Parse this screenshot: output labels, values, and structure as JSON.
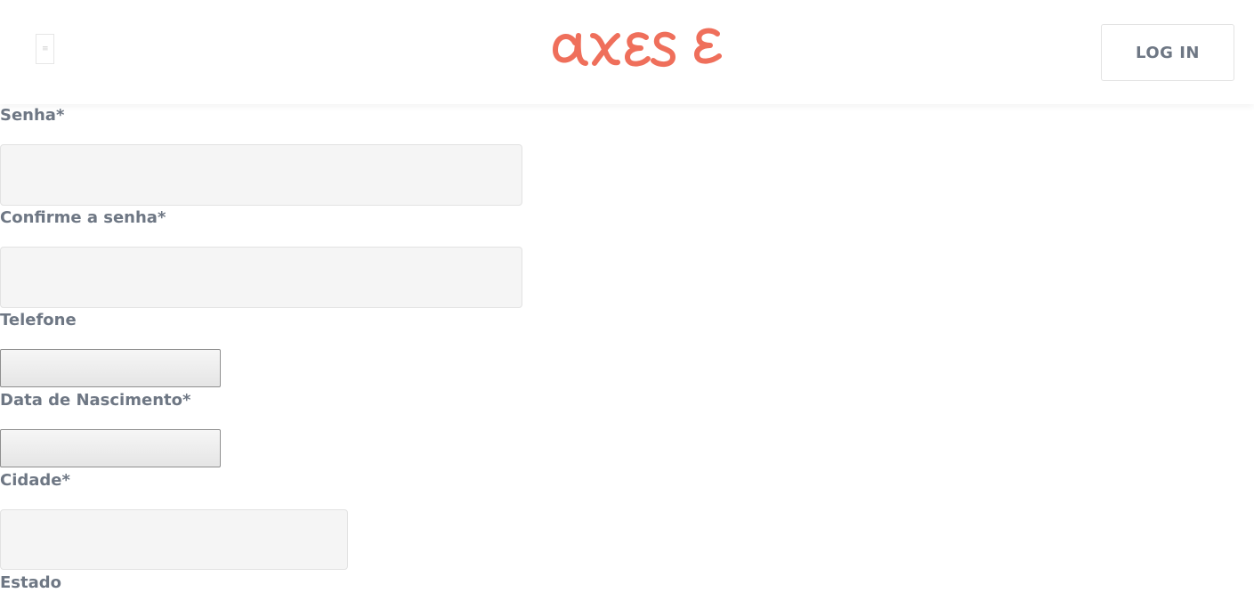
{
  "header": {
    "brand": "AXESE",
    "menu_glyph": "≡",
    "login_label": "LOG IN"
  },
  "colors": {
    "brand": "#ef6f5b",
    "label_text": "#6e7784",
    "input_bg": "#f5f5f5"
  },
  "form": {
    "senha_label": "Senha*",
    "senha_value": "",
    "confirme_label": "Confirme a senha*",
    "confirme_value": "",
    "telefone_label": "Telefone",
    "telefone_value": "",
    "nascimento_label": "Data de Nascimento*",
    "nascimento_value": "",
    "cidade_label": "Cidade*",
    "cidade_value": "",
    "estado_label": "Estado"
  }
}
